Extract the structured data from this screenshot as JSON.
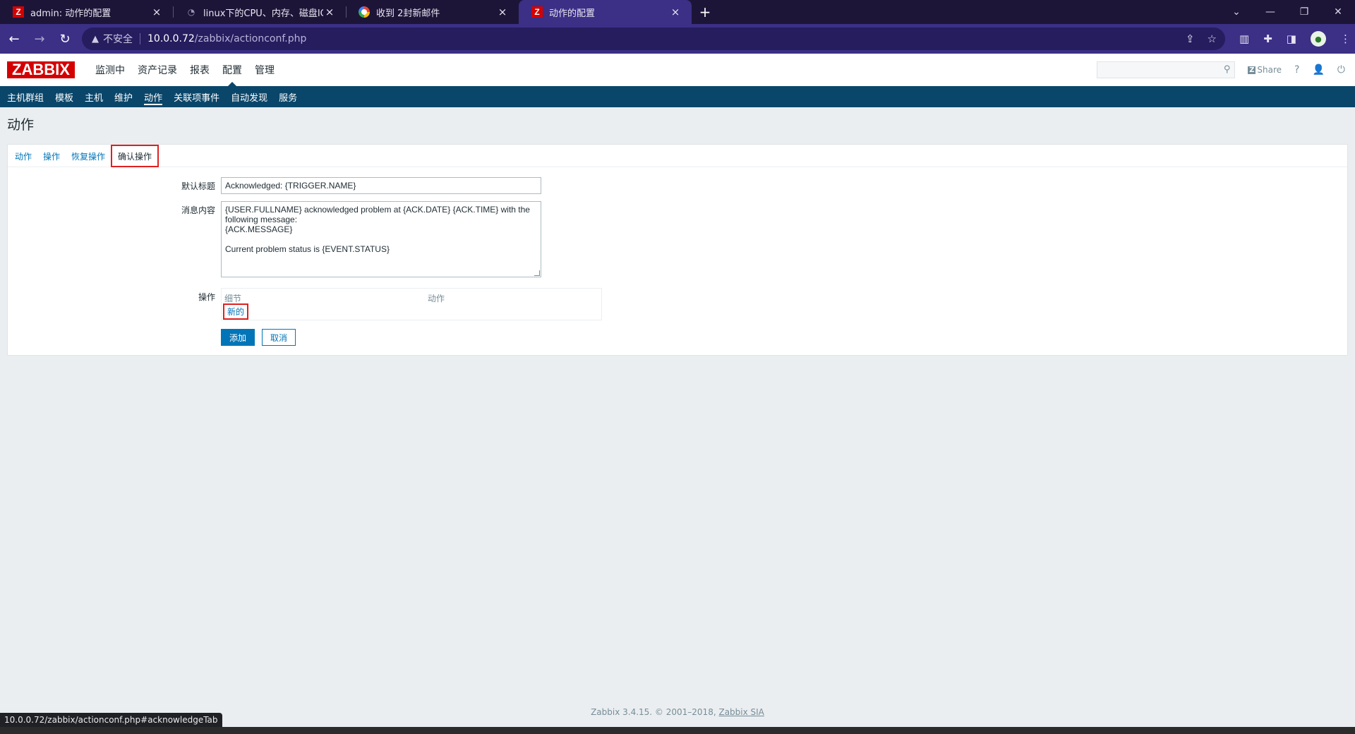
{
  "browser": {
    "tabs": [
      {
        "title": "admin: 动作的配置",
        "icon": "zabbix-icon",
        "active": false
      },
      {
        "title": "linux下的CPU、内存、磁盘IO、",
        "icon": "github-icon",
        "active": false
      },
      {
        "title": "收到 2封新邮件",
        "icon": "mail-icon",
        "active": false
      },
      {
        "title": "动作的配置",
        "icon": "zabbix-icon",
        "active": true
      }
    ],
    "close_glyph": "×",
    "new_tab_glyph": "+",
    "security_label": "不安全",
    "url_host": "10.0.0.72",
    "url_path": "/zabbix/actionconf.php",
    "accent": "#3b2f86"
  },
  "zabbix": {
    "logo": "ZABBIX",
    "top_menu": [
      {
        "label": "监测中",
        "selected": false
      },
      {
        "label": "资产记录",
        "selected": false
      },
      {
        "label": "报表",
        "selected": false
      },
      {
        "label": "配置",
        "selected": true
      },
      {
        "label": "管理",
        "selected": false
      }
    ],
    "share_label": "Share",
    "help_glyph": "?",
    "sub_menu": [
      {
        "label": "主机群组",
        "selected": false
      },
      {
        "label": "模板",
        "selected": false
      },
      {
        "label": "主机",
        "selected": false
      },
      {
        "label": "维护",
        "selected": false
      },
      {
        "label": "动作",
        "selected": true
      },
      {
        "label": "关联项事件",
        "selected": false
      },
      {
        "label": "自动发现",
        "selected": false
      },
      {
        "label": "服务",
        "selected": false
      }
    ]
  },
  "page": {
    "title": "动作",
    "tabs": [
      {
        "label": "动作",
        "active": false
      },
      {
        "label": "操作",
        "active": false
      },
      {
        "label": "恢复操作",
        "active": false
      },
      {
        "label": "确认操作",
        "active": true
      }
    ],
    "form": {
      "subject_label": "默认标题",
      "subject_value": "Acknowledged: {TRIGGER.NAME}",
      "message_label": "消息内容",
      "message_value": "{USER.FULLNAME} acknowledged problem at {ACK.DATE} {ACK.TIME} with the following message:\n{ACK.MESSAGE}\n\nCurrent problem status is {EVENT.STATUS}",
      "operations_label": "操作",
      "ops_col_details": "细节",
      "ops_col_action": "动作",
      "ops_new_link": "新的",
      "add_button": "添加",
      "cancel_button": "取消"
    },
    "footer_text": "Zabbix 3.4.15. © 2001–2018, ",
    "footer_link": "Zabbix SIA"
  },
  "status_url": "10.0.0.72/zabbix/actionconf.php#acknowledgeTab"
}
